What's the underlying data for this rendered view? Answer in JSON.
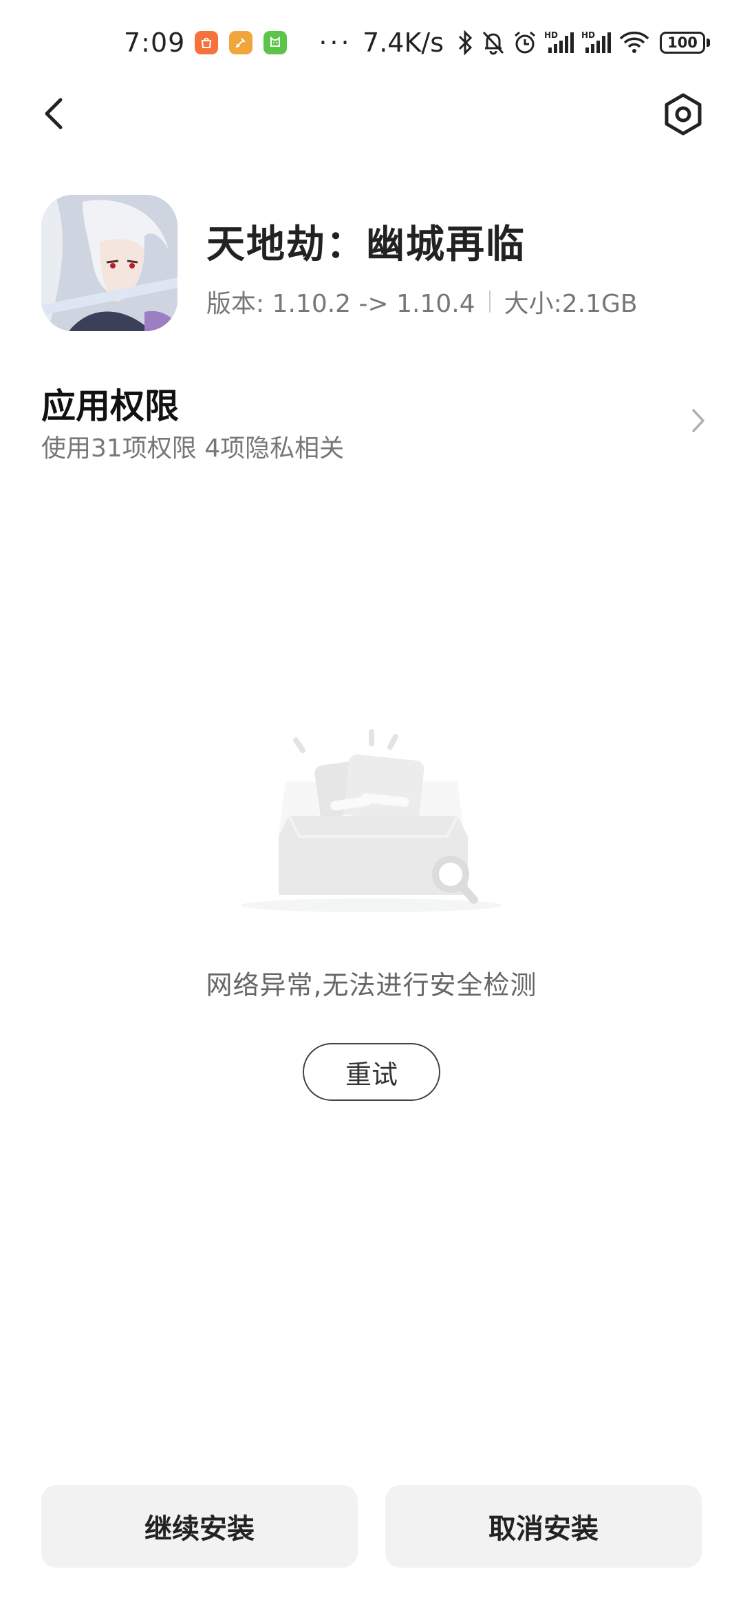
{
  "status_bar": {
    "time": "7:09",
    "more": "···",
    "net_speed": "7.4K/s",
    "battery": "100"
  },
  "nav": {
    "back_icon": "back-arrow-icon",
    "settings_icon": "settings-hexagon-icon"
  },
  "app": {
    "name": "天地劫：幽城再临",
    "version": "版本: 1.10.2 -> 1.10.4",
    "size": "大小:2.1GB"
  },
  "permissions": {
    "title": "应用权限",
    "subtitle": "使用31项权限 4项隐私相关"
  },
  "security_check": {
    "message": "网络异常,无法进行安全检测",
    "retry_label": "重试"
  },
  "actions": {
    "continue_label": "继续安装",
    "cancel_label": "取消安装"
  },
  "colors": {
    "notif_1": "#F5733A",
    "notif_2": "#F0A63A",
    "notif_3": "#5CC448",
    "button_bg": "#F2F2F2"
  }
}
